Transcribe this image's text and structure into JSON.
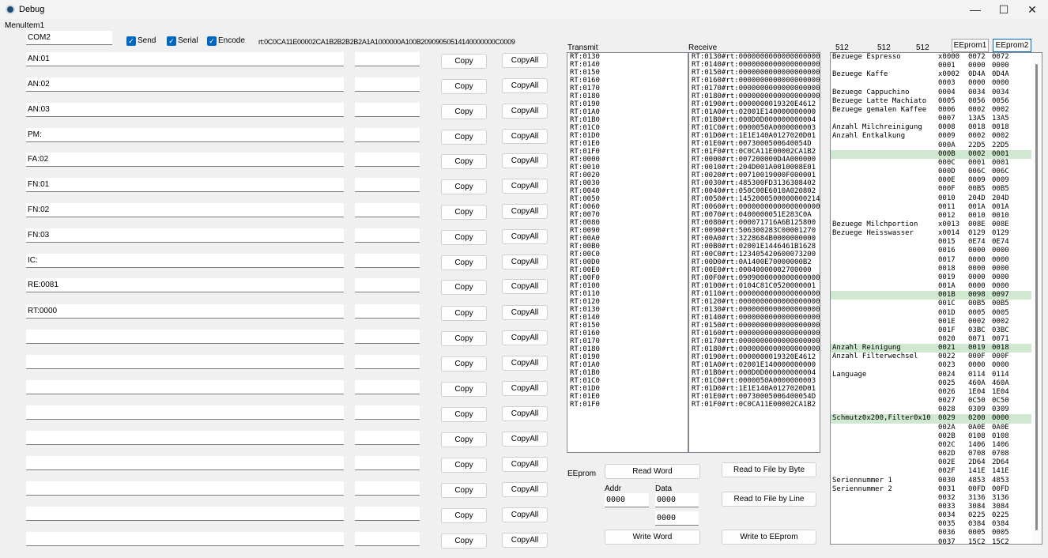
{
  "window": {
    "title": "Debug",
    "minimize": "—",
    "maximize": "☐",
    "close": "✕"
  },
  "menu": {
    "item1": "MenuItem1"
  },
  "top": {
    "port": "COM2",
    "send_label": "Send",
    "serial_label": "Serial",
    "encode_label": "Encode",
    "rt_string": "rt:0C0CA11E00002CA1B2B2B2B2A1A1000000A100B20909050514140000000C0009"
  },
  "rows": [
    {
      "cmd": "AN:01",
      "value": "",
      "copy": "Copy",
      "copyall": "CopyAll"
    },
    {
      "cmd": "AN:02",
      "value": "",
      "copy": "Copy",
      "copyall": "CopyAll"
    },
    {
      "cmd": "AN:03",
      "value": "",
      "copy": "Copy",
      "copyall": "CopyAll"
    },
    {
      "cmd": "PM:",
      "value": "",
      "copy": "Copy",
      "copyall": "CopyAll"
    },
    {
      "cmd": "FA:02",
      "value": "",
      "copy": "Copy",
      "copyall": "CopyAll"
    },
    {
      "cmd": "FN:01",
      "value": "",
      "copy": "Copy",
      "copyall": "CopyAll"
    },
    {
      "cmd": "FN:02",
      "value": "",
      "copy": "Copy",
      "copyall": "CopyAll"
    },
    {
      "cmd": "FN:03",
      "value": "",
      "copy": "Copy",
      "copyall": "CopyAll"
    },
    {
      "cmd": "IC:",
      "value": "",
      "copy": "Copy",
      "copyall": "CopyAll"
    },
    {
      "cmd": "RE:0081",
      "value": "",
      "copy": "Copy",
      "copyall": "CopyAll"
    },
    {
      "cmd": "RT:0000",
      "value": "",
      "copy": "Copy",
      "copyall": "CopyAll"
    },
    {
      "cmd": "",
      "value": "",
      "copy": "Copy",
      "copyall": "CopyAll"
    },
    {
      "cmd": "",
      "value": "",
      "copy": "Copy",
      "copyall": "CopyAll"
    },
    {
      "cmd": "",
      "value": "",
      "copy": "Copy",
      "copyall": "CopyAll"
    },
    {
      "cmd": "",
      "value": "",
      "copy": "Copy",
      "copyall": "CopyAll"
    },
    {
      "cmd": "",
      "value": "",
      "copy": "Copy",
      "copyall": "CopyAll"
    },
    {
      "cmd": "",
      "value": "",
      "copy": "Copy",
      "copyall": "CopyAll"
    },
    {
      "cmd": "",
      "value": "",
      "copy": "Copy",
      "copyall": "CopyAll"
    },
    {
      "cmd": "",
      "value": "",
      "copy": "Copy",
      "copyall": "CopyAll"
    },
    {
      "cmd": "",
      "value": "",
      "copy": "Copy",
      "copyall": "CopyAll"
    }
  ],
  "transmit": {
    "label": "Transmit",
    "items": [
      "RT:0130",
      "RT:0140",
      "RT:0150",
      "RT:0160",
      "RT:0170",
      "RT:0180",
      "RT:0190",
      "RT:01A0",
      "RT:01B0",
      "RT:01C0",
      "RT:01D0",
      "RT:01E0",
      "RT:01F0",
      "RT:0000",
      "RT:0010",
      "RT:0020",
      "RT:0030",
      "RT:0040",
      "RT:0050",
      "RT:0060",
      "RT:0070",
      "RT:0080",
      "RT:0090",
      "RT:00A0",
      "RT:00B0",
      "RT:00C0",
      "RT:00D0",
      "RT:00E0",
      "RT:00F0",
      "RT:0100",
      "RT:0110",
      "RT:0120",
      "RT:0130",
      "RT:0140",
      "RT:0150",
      "RT:0160",
      "RT:0170",
      "RT:0180",
      "RT:0190",
      "RT:01A0",
      "RT:01B0",
      "RT:01C0",
      "RT:01D0",
      "RT:01E0",
      "RT:01F0"
    ]
  },
  "receive": {
    "label": "Receive",
    "items": [
      "RT:0130#rt:0000000000000000000",
      "RT:0140#rt:0000000000000000000",
      "RT:0150#rt:0000000000000000000",
      "RT:0160#rt:0000000000000000000",
      "RT:0170#rt:0000000000000000000",
      "RT:0180#rt:0000000000000000000",
      "RT:0190#rt:0000000019320E4612",
      "RT:01A0#rt:02001E140000000000",
      "RT:01B0#rt:000D0D000000000004",
      "RT:01C0#rt:0000050A0000000003",
      "RT:01D0#rt:1E1E140A0127020D01",
      "RT:01E0#rt:0073000500640054D",
      "RT:01F0#rt:0C0CA11E00002CA1B2",
      "RT:0000#rt:007200000D4A000000",
      "RT:0010#rt:204D001A0010008E01",
      "RT:0020#rt:00710019000F000001",
      "RT:0030#rt:485300FD3136308402",
      "RT:0040#rt:050C00E6010A020802",
      "RT:0050#rt:1452000500000000214",
      "RT:0060#rt:0000000000000000000",
      "RT:0070#rt:0400000051E283C0A",
      "RT:0080#rt:000071716A6B125800",
      "RT:0090#rt:506300283C00001270",
      "RT:00A0#rt:3228684B0000000000",
      "RT:00B0#rt:02001E1446461B1628",
      "RT:00C0#rt:123405420600073200",
      "RT:00D0#rt:0A1400E70000000B2",
      "RT:00E0#rt:00040000002700000",
      "RT:00F0#rt:0909000000000000000",
      "RT:0100#rt:0104C81C0520000001",
      "RT:0110#rt:0000000000000000000",
      "RT:0120#rt:0000000000000000000",
      "RT:0130#rt:0000000000000000000",
      "RT:0140#rt:0000000000000000000",
      "RT:0150#rt:0000000000000000000",
      "RT:0160#rt:0000000000000000000",
      "RT:0170#rt:0000000000000000000",
      "RT:0180#rt:0000000000000000000",
      "RT:0190#rt:0000000019320E4612",
      "RT:01A0#rt:02001E140000000000",
      "RT:01B0#rt:000D0D000000000004",
      "RT:01C0#rt:0000050A0000000003",
      "RT:01D0#rt:1E1E140A0127020D01",
      "RT:01E0#rt:00730005006400054D",
      "RT:01F0#rt:0C0CA11E00002CA1B2"
    ]
  },
  "eeprom": {
    "label": "EEprom",
    "read_word": "Read Word",
    "read_file_byte": "Read to File by Byte",
    "read_file_line": "Read to File by Line",
    "write_word": "Write Word",
    "write_eeprom": "Write to EEprom",
    "addr_label": "Addr",
    "data_label": "Data",
    "addr_value": "0000",
    "data_value": "0000",
    "data_value2": "0000"
  },
  "right": {
    "count1": "512",
    "count2": "512",
    "count3": "512",
    "tab1": "EEprom1",
    "tab2": "EEprom2",
    "highlight_color": "#cfe8cf",
    "rows": [
      {
        "name": "Bezuege Espresso",
        "addr": "x0000",
        "v1": "0072",
        "v2": "0072",
        "hl": false
      },
      {
        "name": "",
        "addr": "0001",
        "v1": "0000",
        "v2": "0000",
        "hl": false
      },
      {
        "name": "Bezuege Kaffe",
        "addr": "x0002",
        "v1": "0D4A",
        "v2": "0D4A",
        "hl": false
      },
      {
        "name": "",
        "addr": "0003",
        "v1": "0000",
        "v2": "0000",
        "hl": false
      },
      {
        "name": "Bezuege Cappuchino",
        "addr": "0004",
        "v1": "0034",
        "v2": "0034",
        "hl": false
      },
      {
        "name": "Bezuege Latte Machiato",
        "addr": "0005",
        "v1": "0056",
        "v2": "0056",
        "hl": false
      },
      {
        "name": "Bezuege gemalen Kaffee",
        "addr": "0006",
        "v1": "0002",
        "v2": "0002",
        "hl": false
      },
      {
        "name": "",
        "addr": "0007",
        "v1": "13A5",
        "v2": "13A5",
        "hl": false
      },
      {
        "name": "Anzahl Milchreinigung",
        "addr": "0008",
        "v1": "0018",
        "v2": "0018",
        "hl": false
      },
      {
        "name": "Anzahl Entkalkung",
        "addr": "0009",
        "v1": "0002",
        "v2": "0002",
        "hl": false
      },
      {
        "name": "",
        "addr": "000A",
        "v1": "22D5",
        "v2": "22D5",
        "hl": false
      },
      {
        "name": "",
        "addr": "000B",
        "v1": "0002",
        "v2": "0001",
        "hl": true
      },
      {
        "name": "",
        "addr": "000C",
        "v1": "0001",
        "v2": "0001",
        "hl": false
      },
      {
        "name": "",
        "addr": "000D",
        "v1": "006C",
        "v2": "006C",
        "hl": false
      },
      {
        "name": "",
        "addr": "000E",
        "v1": "0009",
        "v2": "0009",
        "hl": false
      },
      {
        "name": "",
        "addr": "000F",
        "v1": "00B5",
        "v2": "00B5",
        "hl": false
      },
      {
        "name": "",
        "addr": "0010",
        "v1": "204D",
        "v2": "204D",
        "hl": false
      },
      {
        "name": "",
        "addr": "0011",
        "v1": "001A",
        "v2": "001A",
        "hl": false
      },
      {
        "name": "",
        "addr": "0012",
        "v1": "0010",
        "v2": "0010",
        "hl": false
      },
      {
        "name": "Bezuege Milchportion",
        "addr": "x0013",
        "v1": "008E",
        "v2": "008E",
        "hl": false
      },
      {
        "name": "Bezuege Heisswasser",
        "addr": "x0014",
        "v1": "0129",
        "v2": "0129",
        "hl": false
      },
      {
        "name": "",
        "addr": "0015",
        "v1": "0E74",
        "v2": "0E74",
        "hl": false
      },
      {
        "name": "",
        "addr": "0016",
        "v1": "0000",
        "v2": "0000",
        "hl": false
      },
      {
        "name": "",
        "addr": "0017",
        "v1": "0000",
        "v2": "0000",
        "hl": false
      },
      {
        "name": "",
        "addr": "0018",
        "v1": "0000",
        "v2": "0000",
        "hl": false
      },
      {
        "name": "",
        "addr": "0019",
        "v1": "0000",
        "v2": "0000",
        "hl": false
      },
      {
        "name": "",
        "addr": "001A",
        "v1": "0000",
        "v2": "0000",
        "hl": false
      },
      {
        "name": "",
        "addr": "001B",
        "v1": "0098",
        "v2": "0097",
        "hl": true
      },
      {
        "name": "",
        "addr": "001C",
        "v1": "00B5",
        "v2": "00B5",
        "hl": false
      },
      {
        "name": "",
        "addr": "001D",
        "v1": "0005",
        "v2": "0005",
        "hl": false
      },
      {
        "name": "",
        "addr": "001E",
        "v1": "0002",
        "v2": "0002",
        "hl": false
      },
      {
        "name": "",
        "addr": "001F",
        "v1": "03BC",
        "v2": "03BC",
        "hl": false
      },
      {
        "name": "",
        "addr": "0020",
        "v1": "0071",
        "v2": "0071",
        "hl": false
      },
      {
        "name": "Anzahl Reinigung",
        "addr": "0021",
        "v1": "0019",
        "v2": "0018",
        "hl": true
      },
      {
        "name": "Anzahl Filterwechsel",
        "addr": "0022",
        "v1": "000F",
        "v2": "000F",
        "hl": false
      },
      {
        "name": "",
        "addr": "0023",
        "v1": "0000",
        "v2": "0000",
        "hl": false
      },
      {
        "name": "Language",
        "addr": "0024",
        "v1": "0114",
        "v2": "0114",
        "hl": false
      },
      {
        "name": "",
        "addr": "0025",
        "v1": "460A",
        "v2": "460A",
        "hl": false
      },
      {
        "name": "",
        "addr": "0026",
        "v1": "1E04",
        "v2": "1E04",
        "hl": false
      },
      {
        "name": "",
        "addr": "0027",
        "v1": "0C50",
        "v2": "0C50",
        "hl": false
      },
      {
        "name": "",
        "addr": "0028",
        "v1": "0309",
        "v2": "0309",
        "hl": false
      },
      {
        "name": "Schmutz0x200,Filter0x10",
        "addr": "0029",
        "v1": "0200",
        "v2": "0000",
        "hl": true
      },
      {
        "name": "",
        "addr": "002A",
        "v1": "0A0E",
        "v2": "0A0E",
        "hl": false
      },
      {
        "name": "",
        "addr": "002B",
        "v1": "0108",
        "v2": "0108",
        "hl": false
      },
      {
        "name": "",
        "addr": "002C",
        "v1": "1406",
        "v2": "1406",
        "hl": false
      },
      {
        "name": "",
        "addr": "002D",
        "v1": "0708",
        "v2": "0708",
        "hl": false
      },
      {
        "name": "",
        "addr": "002E",
        "v1": "2D64",
        "v2": "2D64",
        "hl": false
      },
      {
        "name": "",
        "addr": "002F",
        "v1": "141E",
        "v2": "141E",
        "hl": false
      },
      {
        "name": "Seriennummer 1",
        "addr": "0030",
        "v1": "4853",
        "v2": "4853",
        "hl": false
      },
      {
        "name": "Seriennummer 2",
        "addr": "0031",
        "v1": "00FD",
        "v2": "00FD",
        "hl": false
      },
      {
        "name": "",
        "addr": "0032",
        "v1": "3136",
        "v2": "3136",
        "hl": false
      },
      {
        "name": "",
        "addr": "0033",
        "v1": "3084",
        "v2": "3084",
        "hl": false
      },
      {
        "name": "",
        "addr": "0034",
        "v1": "0225",
        "v2": "0225",
        "hl": false
      },
      {
        "name": "",
        "addr": "0035",
        "v1": "0384",
        "v2": "0384",
        "hl": false
      },
      {
        "name": "",
        "addr": "0036",
        "v1": "0005",
        "v2": "0005",
        "hl": false
      },
      {
        "name": "",
        "addr": "0037",
        "v1": "15C2",
        "v2": "15C2",
        "hl": false
      }
    ]
  }
}
